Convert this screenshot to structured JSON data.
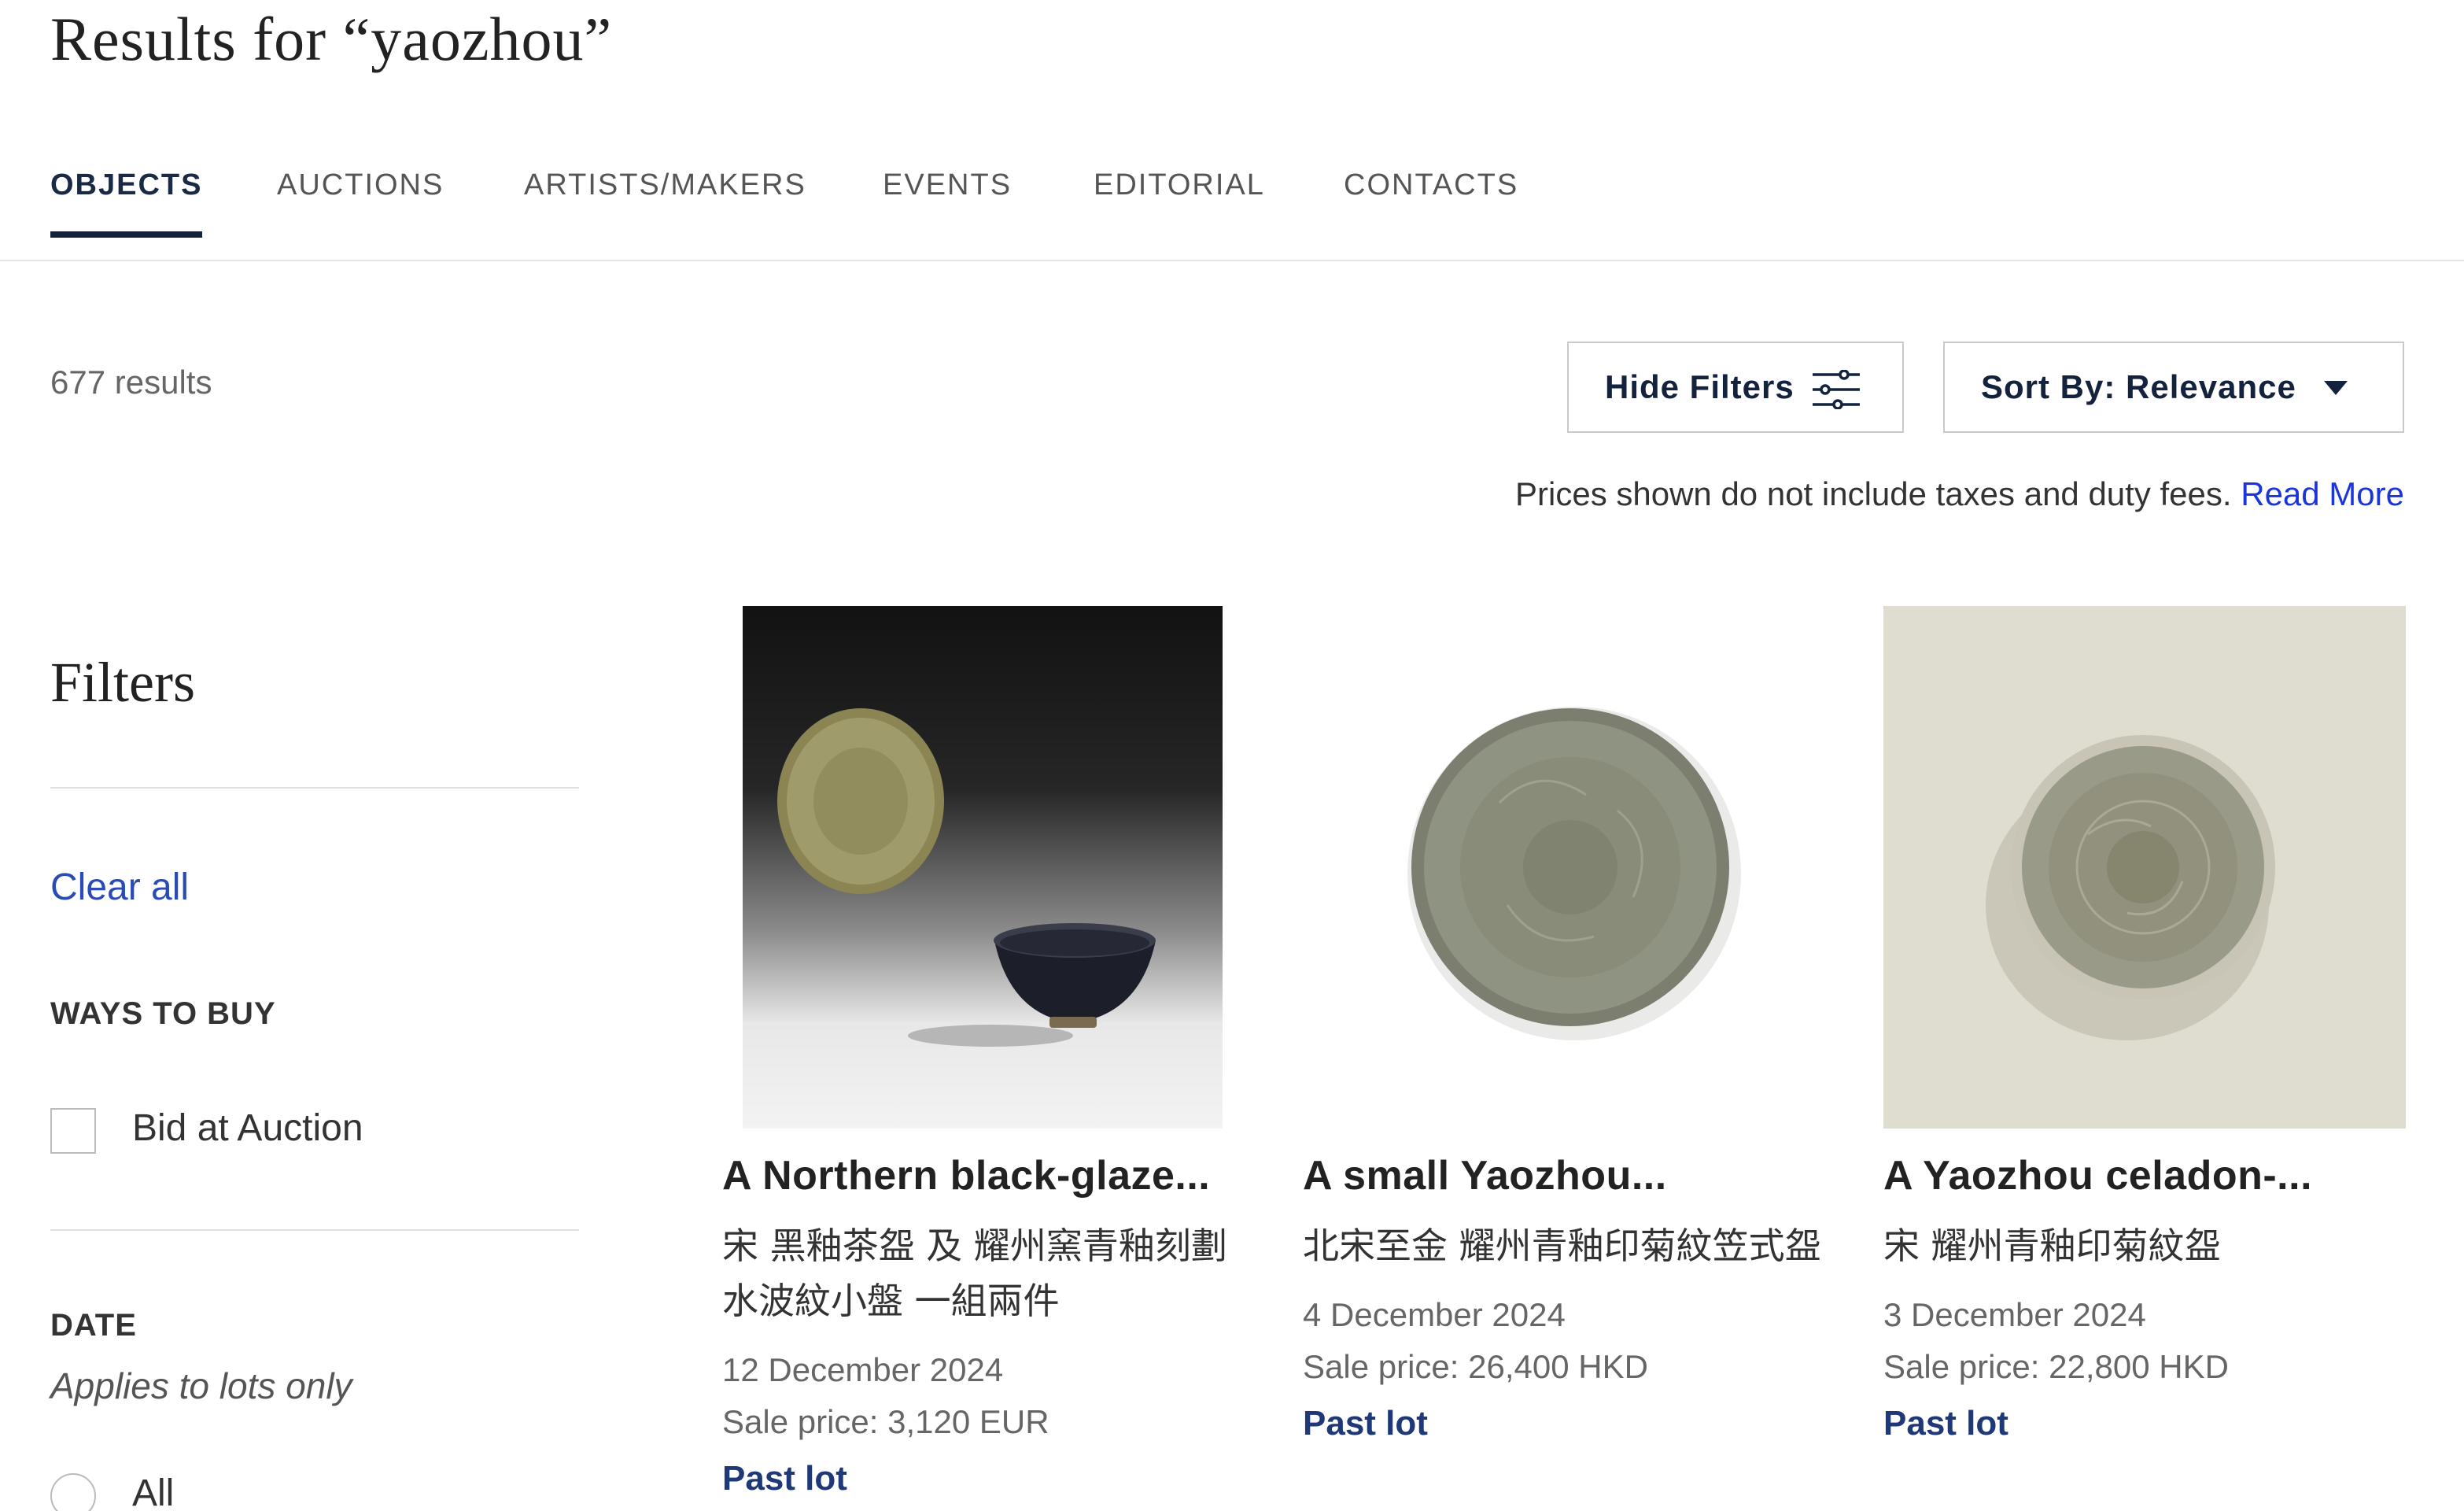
{
  "page": {
    "title": "Results for “yaozhou”"
  },
  "tabs": [
    {
      "label": "OBJECTS",
      "active": true
    },
    {
      "label": "AUCTIONS"
    },
    {
      "label": "ARTISTS/MAKERS"
    },
    {
      "label": "EVENTS"
    },
    {
      "label": "EDITORIAL"
    },
    {
      "label": "CONTACTS"
    }
  ],
  "results": {
    "count_text": "677 results"
  },
  "controls": {
    "hide_filters_label": "Hide Filters",
    "sort_label": "Sort By: Relevance"
  },
  "notice": {
    "text": "Prices shown do not include taxes and duty fees.",
    "link": "Read More"
  },
  "filters": {
    "heading": "Filters",
    "clear_all": "Clear all",
    "ways_to_buy": {
      "label": "WAYS TO BUY",
      "option": "Bid at Auction"
    },
    "date": {
      "label": "DATE",
      "note": "Applies to lots only",
      "option": "All"
    }
  },
  "lots": [
    {
      "title": "A Northern black-glaze...",
      "subtitle": "宋 黑釉茶盌 及 耀州窯青釉刻劃水波紋小盤 一組兩件",
      "date": "12 December 2024",
      "price": "Sale price: 3,120 EUR",
      "status": "Past lot"
    },
    {
      "title": "A small Yaozhou...",
      "subtitle": "北宋至金 耀州青釉印菊紋笠式盌",
      "date": "4 December 2024",
      "price": "Sale price: 26,400 HKD",
      "status": "Past lot"
    },
    {
      "title": "A Yaozhou celadon-...",
      "subtitle": "宋 耀州青釉印菊紋盌",
      "date": "3 December 2024",
      "price": "Sale price: 22,800 HKD",
      "status": "Past lot"
    }
  ],
  "colors": {
    "brand_navy": "#14233d",
    "link_blue": "#1a36d9",
    "lot_status": "#1f3878"
  },
  "icons": {
    "hide_filters": "sliders-icon",
    "sort": "caret-down-icon"
  }
}
